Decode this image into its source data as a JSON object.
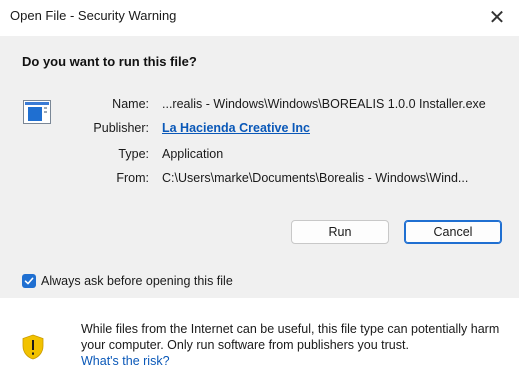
{
  "window": {
    "title": "Open File - Security Warning",
    "close_symbol": "✕"
  },
  "dialog": {
    "question": "Do you want to run this file?",
    "file_icon": "application-window-icon",
    "fields": [
      {
        "label": "Name:",
        "value": "...realis - Windows\\Windows\\BOREALIS 1.0.0 Installer.exe"
      },
      {
        "label": "Publisher:",
        "value": "La Hacienda Creative Inc"
      },
      {
        "label": "Type:",
        "value": "Application"
      },
      {
        "label": "From:",
        "value": "C:\\Users\\marke\\Documents\\Borealis - Windows\\Wind..."
      }
    ],
    "run_label": "Run",
    "cancel_label": "Cancel",
    "checkbox_label": "Always ask before opening this file",
    "checkbox_checked": true
  },
  "footer": {
    "warning_icon": "shield-warning-icon",
    "text": "While files from the Internet can be useful, this file type can potentially harm your computer. Only run software from publishers you trust.",
    "risk_link": "What's the risk?"
  },
  "colors": {
    "accent": "#1f6fd1",
    "link": "#0a58b8",
    "panel": "#f0f0f0",
    "shield": "#f2c200"
  }
}
